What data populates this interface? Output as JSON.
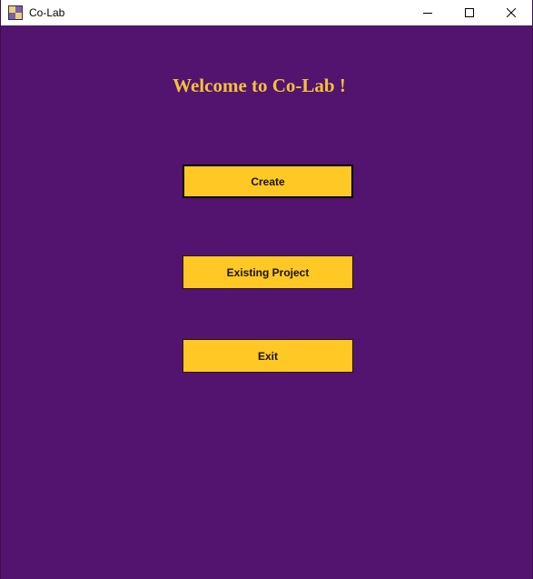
{
  "window": {
    "title": "Co-Lab",
    "background_color": "#52146f",
    "icons": {
      "app": "app-icon",
      "minimize": "minimize-icon",
      "maximize": "maximize-icon",
      "close": "close-icon"
    }
  },
  "main": {
    "heading": "Welcome to Co-Lab !",
    "heading_color": "#f3c13a",
    "button_color": "#ffc824",
    "buttons": [
      {
        "label": "Create",
        "focused": true
      },
      {
        "label": "Existing Project",
        "focused": false
      },
      {
        "label": "Exit",
        "focused": false
      }
    ]
  }
}
